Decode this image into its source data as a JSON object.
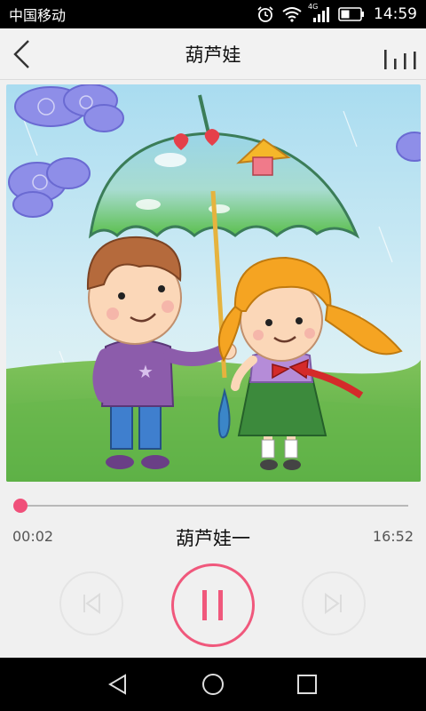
{
  "status_bar": {
    "carrier": "中国移动",
    "network_type": "4G",
    "time": "14:59",
    "icons": [
      "alarm-icon",
      "wifi-icon",
      "signal-icon",
      "battery-icon"
    ]
  },
  "header": {
    "title": "葫芦娃",
    "back_icon": "chevron-left-icon",
    "equalizer_icon": "equalizer-icon"
  },
  "player": {
    "track_title": "葫芦娃一",
    "elapsed": "00:02",
    "duration": "16:52",
    "progress": 0.002,
    "state": "playing",
    "controls": [
      "prev-icon",
      "pause-icon",
      "next-icon"
    ]
  },
  "nav_bar": {
    "icons": [
      "back-triangle-icon",
      "home-circle-icon",
      "recents-square-icon"
    ]
  },
  "colors": {
    "accent": "#f0507a",
    "status_bar_bg": "#000000",
    "background": "#f0f0f0"
  }
}
